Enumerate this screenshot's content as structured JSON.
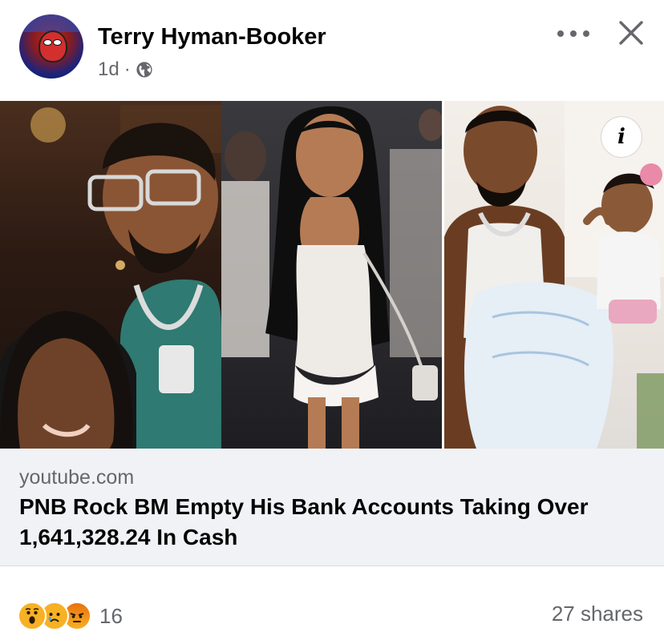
{
  "post": {
    "author": "Terry Hyman-Booker",
    "time": "1d",
    "separator": "·",
    "audience_icon": "globe-icon"
  },
  "link_preview": {
    "domain": "youtube.com",
    "title": "PNB Rock BM Empty His Bank Accounts Taking Over 1,641,328.24 In Cash",
    "info_label": "i"
  },
  "engagement": {
    "reaction_icons": [
      "wow-reaction-icon",
      "sad-reaction-icon",
      "angry-reaction-icon"
    ],
    "reaction_count": "16",
    "shares": "27 shares"
  },
  "colors": {
    "secondary_text": "#65676b",
    "card_background": "#f0f2f5",
    "reaction_yellow": "#f7b125"
  }
}
